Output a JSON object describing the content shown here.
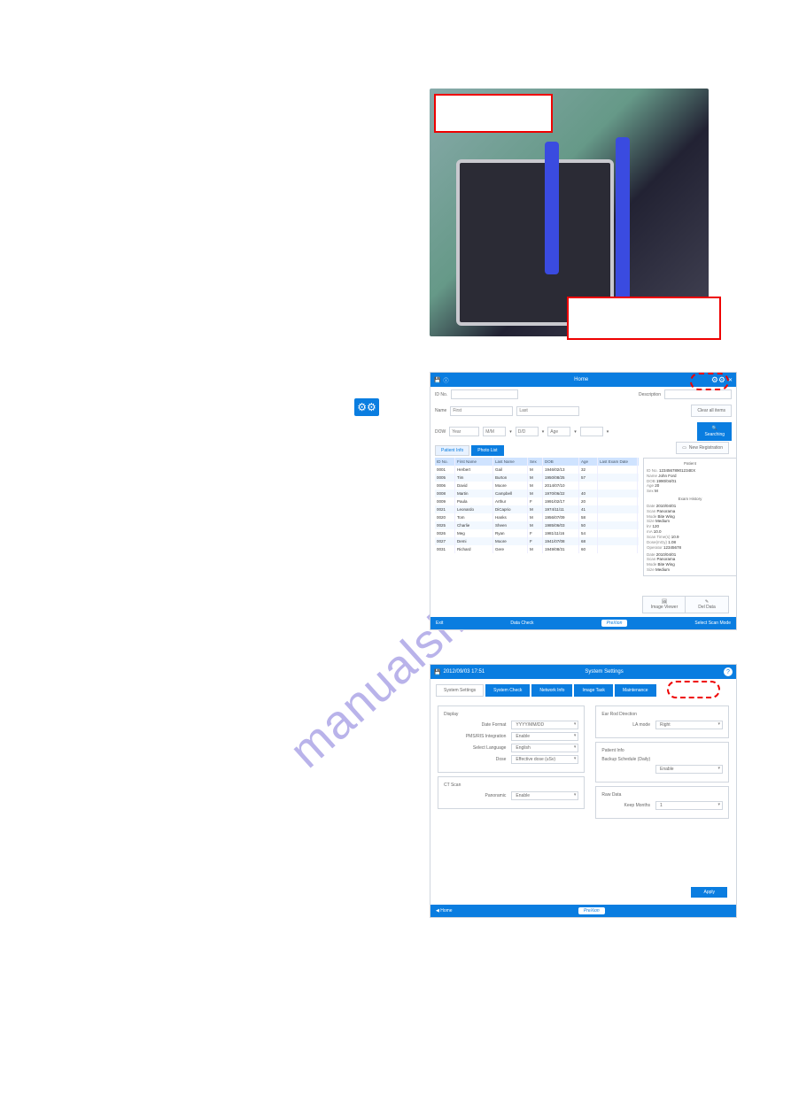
{
  "watermark": "manualshive.com",
  "left": {
    "step2_gear": "⚙⚙",
    "step_text_1": "",
    "step_text_2": ""
  },
  "photo": {
    "label_top": "",
    "label_bottom": ""
  },
  "app1": {
    "title": "",
    "header_text": "Home",
    "search": {
      "idno_label": "ID No.",
      "idno_value": "",
      "desc_label": "Description",
      "desc_value": "",
      "clear_btn": "Clear all items",
      "name_label": "Name",
      "first_ph": "First",
      "last_ph": "Last",
      "dow_label": "DOW",
      "year_ph": "Year",
      "mm_ph": "M/M",
      "dd_ph": "D/D",
      "age_ph": "Age",
      "sex_ph": "",
      "search_btn": "Searching"
    },
    "tabs": {
      "patient": "Patient Info",
      "photo": "Photo List"
    },
    "new_registration": "New Registration",
    "columns": [
      "ID No.",
      "First Name",
      "Last Name",
      "Sex",
      "DOB",
      "Age",
      "Last Exam Date"
    ],
    "rows": [
      {
        "id": "0001",
        "fn": "Herbert",
        "ln": "Gail",
        "sex": "M",
        "dob": "1946/02/13",
        "age": "32",
        "led": ""
      },
      {
        "id": "0005",
        "fn": "Tim",
        "ln": "Burton",
        "sex": "M",
        "dob": "1950/08/25",
        "age": "57",
        "led": ""
      },
      {
        "id": "0006",
        "fn": "David",
        "ln": "Moore",
        "sex": "M",
        "dob": "2014/07/10",
        "age": "",
        "led": ""
      },
      {
        "id": "0008",
        "fn": "Martin",
        "ln": "Campbell",
        "sex": "M",
        "dob": "1970/06/22",
        "age": "40",
        "led": ""
      },
      {
        "id": "0009",
        "fn": "Paula",
        "ln": "Arthur",
        "sex": "F",
        "dob": "1991/02/17",
        "age": "20",
        "led": ""
      },
      {
        "id": "0021",
        "fn": "Leonardo",
        "ln": "DiCaprio",
        "sex": "M",
        "dob": "1974/11/11",
        "age": "41",
        "led": ""
      },
      {
        "id": "0020",
        "fn": "Tom",
        "ln": "Hanks",
        "sex": "M",
        "dob": "1956/07/09",
        "age": "58",
        "led": ""
      },
      {
        "id": "0025",
        "fn": "Charlie",
        "ln": "Sheen",
        "sex": "M",
        "dob": "1985/06/03",
        "age": "50",
        "led": ""
      },
      {
        "id": "0026",
        "fn": "Meg",
        "ln": "Ryan",
        "sex": "F",
        "dob": "1981/11/16",
        "age": "54",
        "led": ""
      },
      {
        "id": "0027",
        "fn": "Demi",
        "ln": "Moore",
        "sex": "F",
        "dob": "1941/07/08",
        "age": "68",
        "led": ""
      },
      {
        "id": "0031",
        "fn": "Richard",
        "ln": "Gere",
        "sex": "M",
        "dob": "1949/08/31",
        "age": "60",
        "led": ""
      }
    ],
    "patient_panel": {
      "title": "Patient",
      "idno_k": "ID No.",
      "idno_v": "12345678901234EX",
      "name_k": "Name",
      "name_v": "John Ford",
      "dob_k": "DOB",
      "dob_v": "1990/04/01",
      "age_k": "Age",
      "age_v": "20",
      "sex_k": "Sex",
      "sex_v": "M",
      "exam_title": "Exam History",
      "date_k": "Date",
      "date_v": "2010/04/01",
      "scan_k": "Scan",
      "scan_v": "Panorama",
      "mode_k": "Mode",
      "mode_v": "Bite Wing",
      "size_k": "Size",
      "size_v": "Medium",
      "kv_k": "kV",
      "kv_v": "120",
      "ma_k": "mA",
      "ma_v": "10.0",
      "st_k": "Scan Time(s)",
      "st_v": "10.9",
      "dose_k": "Dose(mGy)",
      "dose_v": "1.08",
      "op_k": "Operator",
      "op_v": "12345678",
      "date2_k": "Date",
      "date2_v": "2010/04/01",
      "scan2_k": "Scan",
      "scan2_v": "Panorama",
      "mode2_k": "Mode",
      "mode2_v": "Bite Wing",
      "size2_k": "Size",
      "size2_v": "Medium"
    },
    "btn_image_viewer": "Image Viewer",
    "btn_del_data": "Del Data",
    "bottom": {
      "left": "Exit",
      "mid": "Data Check",
      "logo": "PreXion",
      "right": "Select Scan Mode"
    }
  },
  "app2": {
    "datetime": "2012/09/03 17:51",
    "title": "System Settings",
    "help": "?",
    "tabs": [
      "System Settings",
      "System Check",
      "Network Info",
      "Image Task",
      "Maintenance"
    ],
    "display": {
      "title": "Display",
      "date_format_l": "Date Format",
      "date_format_v": "YYYY/MM/DD",
      "pms_l": "PMS/RIS Integration",
      "pms_v": "Enable",
      "lang_l": "Select Language",
      "lang_v": "English",
      "dose_l": "Dose",
      "dose_v": "Effective dose (uSv)"
    },
    "ctscan": {
      "title": "CT Scan",
      "pano_l": "Panoramic",
      "pano_v": "Enable"
    },
    "earrod": {
      "title": "Ear Rod Direction",
      "la_l": "LA mode",
      "la_v": "Right"
    },
    "pinfo": {
      "title": "Patient Info",
      "backup_l": "Backup Schedule (Daily)",
      "backup_v": "Enable"
    },
    "rawdata": {
      "title": "Raw Data",
      "keep_l": "Keep Months",
      "keep_v": "1"
    },
    "apply": "Apply",
    "bottom": {
      "home": "Home",
      "logo": "PreXion"
    }
  }
}
